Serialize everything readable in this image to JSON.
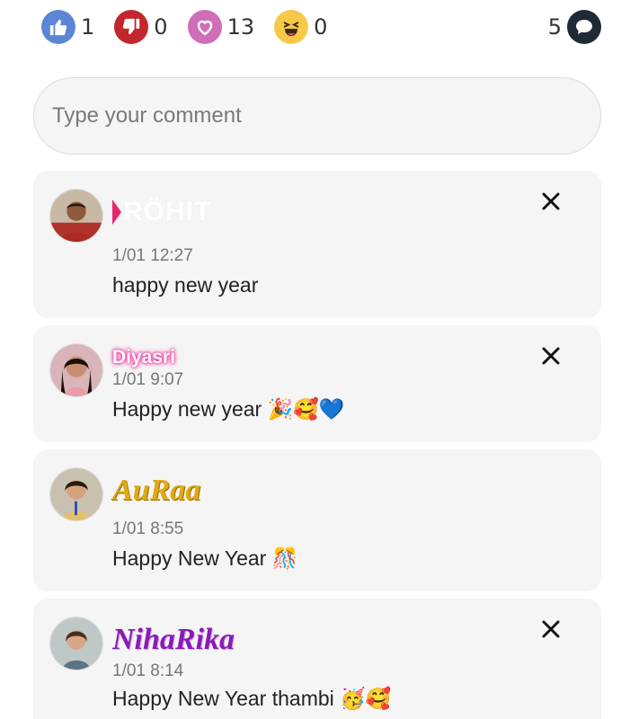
{
  "reactions": [
    {
      "name": "like",
      "count": "1",
      "color": "#5b86d6"
    },
    {
      "name": "dislike",
      "count": "0",
      "color": "#c0282d"
    },
    {
      "name": "love",
      "count": "13",
      "color": "#cf6eb7"
    },
    {
      "name": "laugh",
      "count": "0",
      "color": "#f7c948"
    }
  ],
  "comments_count": "5",
  "comment_input": {
    "placeholder": "Type your comment",
    "value": ""
  },
  "comments": [
    {
      "author": "RÖHIT",
      "time": "1/01 12:27",
      "text": "happy new year"
    },
    {
      "author": "Diyasri",
      "time": "1/01 9:07",
      "text": "Happy new year 🎉🥰💙"
    },
    {
      "author": "AuRaa",
      "time": "1/01 8:55",
      "text": "Happy New Year 🎊"
    },
    {
      "author": "NihaRika",
      "time": "1/01 8:14",
      "text": "Happy New Year thambi 🥳🥰"
    }
  ],
  "icons": {
    "close": "close-icon",
    "comment": "comment-bubble-icon",
    "like": "thumbs-up-icon",
    "dislike": "thumbs-down-icon",
    "love": "heart-icon",
    "laugh": "laughing-face-icon"
  }
}
